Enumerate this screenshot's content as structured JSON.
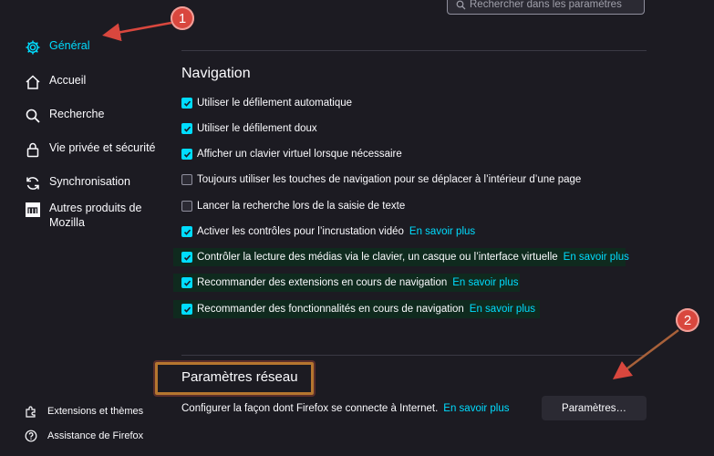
{
  "search": {
    "placeholder": "Rechercher dans les paramètres"
  },
  "sidebar": {
    "items": [
      {
        "label": "Général",
        "icon": "gear-icon",
        "active": true
      },
      {
        "label": "Accueil",
        "icon": "home-icon"
      },
      {
        "label": "Recherche",
        "icon": "search-icon"
      },
      {
        "label": "Vie privée et sécurité",
        "icon": "lock-icon"
      },
      {
        "label": "Synchronisation",
        "icon": "sync-icon"
      },
      {
        "label": "Autres produits de Mozilla",
        "icon": "mozilla-icon"
      }
    ],
    "footer": [
      {
        "label": "Extensions et thèmes",
        "icon": "puzzle-icon"
      },
      {
        "label": "Assistance de Firefox",
        "icon": "help-icon"
      }
    ]
  },
  "navigation": {
    "title": "Navigation",
    "options": [
      {
        "label": "Utiliser le défilement automatique",
        "checked": true
      },
      {
        "label": "Utiliser le défilement doux",
        "checked": true
      },
      {
        "label": "Afficher un clavier virtuel lorsque nécessaire",
        "checked": true
      },
      {
        "label": "Toujours utiliser les touches de navigation pour se déplacer à l’intérieur d’une page",
        "checked": false
      },
      {
        "label": "Lancer la recherche lors de la saisie de texte",
        "checked": false
      },
      {
        "label": "Activer les contrôles pour l’incrustation vidéo",
        "checked": true,
        "link": "En savoir plus"
      },
      {
        "label": "Contrôler la lecture des médias via le clavier, un casque ou l’interface virtuelle",
        "checked": true,
        "link": "En savoir plus"
      },
      {
        "label": "Recommander des extensions en cours de navigation",
        "checked": true,
        "link": "En savoir plus"
      },
      {
        "label": "Recommander des fonctionnalités en cours de navigation",
        "checked": true,
        "link": "En savoir plus"
      }
    ]
  },
  "network": {
    "title": "Paramètres réseau",
    "description": "Configurer la façon dont Firefox se connecte à Internet.",
    "link": "En savoir plus",
    "button": "Paramètres…"
  },
  "annotations": {
    "badge1": "1",
    "badge2": "2"
  },
  "colors": {
    "accent": "#00ddff",
    "background": "#1c1b22",
    "annotation": "#d9473e"
  }
}
